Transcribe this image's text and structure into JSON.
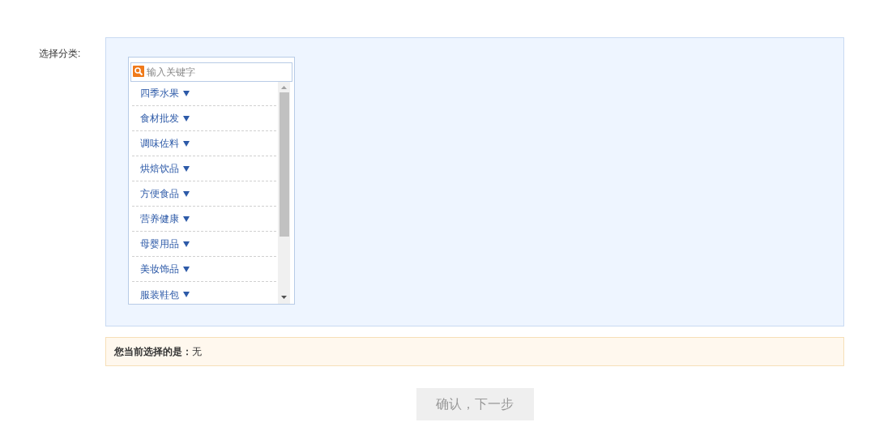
{
  "category_label": "选择分类:",
  "search": {
    "placeholder": "输入关键字"
  },
  "categories": [
    {
      "label": "四季水果"
    },
    {
      "label": "食材批发"
    },
    {
      "label": "调味佐料"
    },
    {
      "label": "烘焙饮品"
    },
    {
      "label": "方便食品"
    },
    {
      "label": "营养健康"
    },
    {
      "label": "母婴用品"
    },
    {
      "label": "美妆饰品"
    },
    {
      "label": "服装鞋包"
    }
  ],
  "current_selection": "**您当前选择的是：**无",
  "confirm_button": {
    "label": "确认，下一步",
    "disabled": true
  }
}
